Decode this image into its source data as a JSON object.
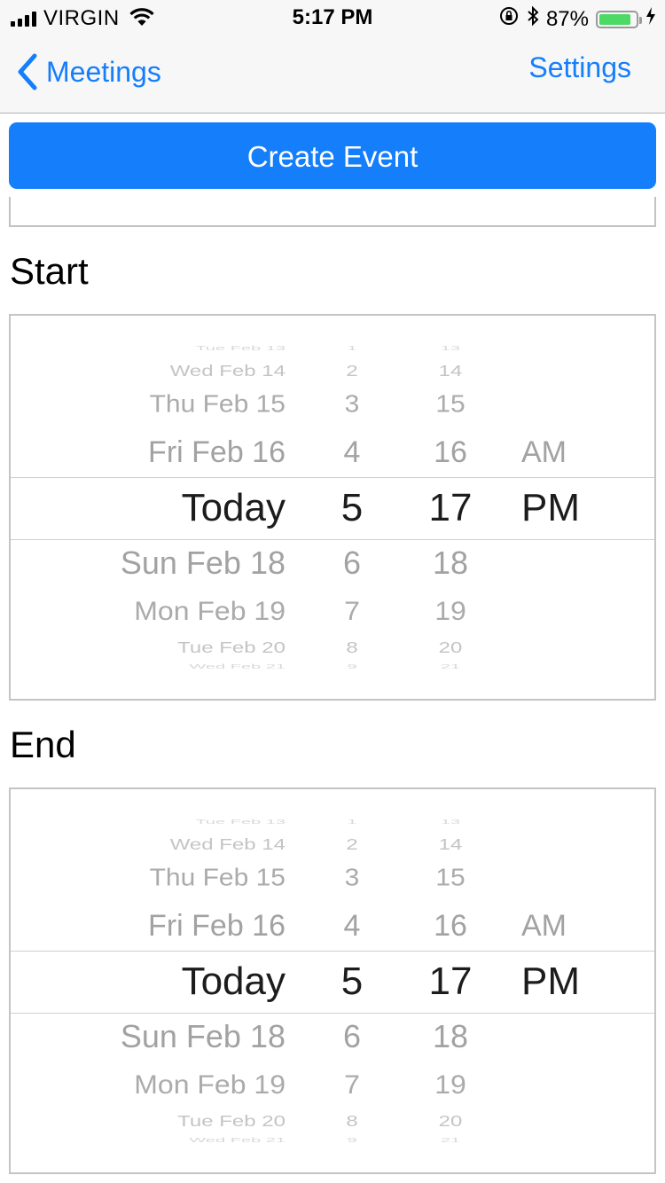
{
  "status_bar": {
    "carrier": "VIRGIN",
    "time": "5:17 PM",
    "battery_percent": "87%",
    "battery_level": 0.87,
    "icons": [
      "signal-icon",
      "wifi-icon",
      "orientation-lock-icon",
      "bluetooth-icon",
      "battery-icon",
      "charging-icon"
    ]
  },
  "nav": {
    "back_label": "Meetings",
    "settings_label": "Settings"
  },
  "create_button_label": "Create Event",
  "colors": {
    "accent": "#157efb",
    "battery": "#4cd964"
  },
  "start": {
    "label": "Start",
    "rows": [
      {
        "date": "Tue Feb 13",
        "hour": "1",
        "minute": "13",
        "ampm": ""
      },
      {
        "date": "Wed Feb 14",
        "hour": "2",
        "minute": "14",
        "ampm": ""
      },
      {
        "date": "Thu Feb 15",
        "hour": "3",
        "minute": "15",
        "ampm": ""
      },
      {
        "date": "Fri Feb 16",
        "hour": "4",
        "minute": "16",
        "ampm": "AM"
      },
      {
        "date": "Today",
        "hour": "5",
        "minute": "17",
        "ampm": "PM"
      },
      {
        "date": "Sun Feb 18",
        "hour": "6",
        "minute": "18",
        "ampm": ""
      },
      {
        "date": "Mon Feb 19",
        "hour": "7",
        "minute": "19",
        "ampm": ""
      },
      {
        "date": "Tue Feb 20",
        "hour": "8",
        "minute": "20",
        "ampm": ""
      },
      {
        "date": "Wed Feb 21",
        "hour": "9",
        "minute": "21",
        "ampm": ""
      }
    ]
  },
  "end": {
    "label": "End",
    "rows": [
      {
        "date": "Tue Feb 13",
        "hour": "1",
        "minute": "13",
        "ampm": ""
      },
      {
        "date": "Wed Feb 14",
        "hour": "2",
        "minute": "14",
        "ampm": ""
      },
      {
        "date": "Thu Feb 15",
        "hour": "3",
        "minute": "15",
        "ampm": ""
      },
      {
        "date": "Fri Feb 16",
        "hour": "4",
        "minute": "16",
        "ampm": "AM"
      },
      {
        "date": "Today",
        "hour": "5",
        "minute": "17",
        "ampm": "PM"
      },
      {
        "date": "Sun Feb 18",
        "hour": "6",
        "minute": "18",
        "ampm": ""
      },
      {
        "date": "Mon Feb 19",
        "hour": "7",
        "minute": "19",
        "ampm": ""
      },
      {
        "date": "Tue Feb 20",
        "hour": "8",
        "minute": "20",
        "ampm": ""
      },
      {
        "date": "Wed Feb 21",
        "hour": "9",
        "minute": "21",
        "ampm": ""
      }
    ]
  }
}
